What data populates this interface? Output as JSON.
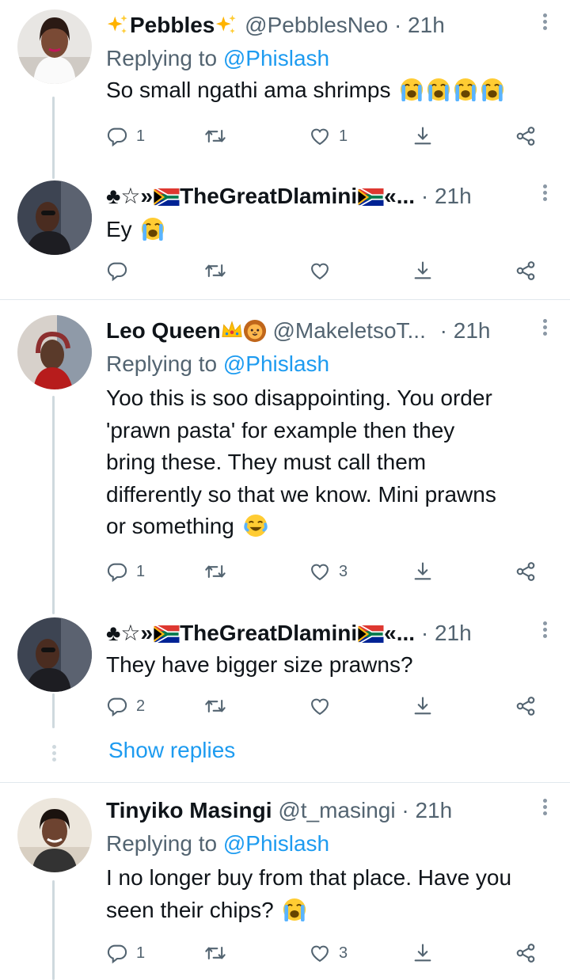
{
  "reply_prefix": "Replying to ",
  "tweets": [
    {
      "name": "Pebbles",
      "handle": "@PebblesNeo",
      "time": "21h",
      "reply_to": "@Phislash",
      "text": "So small ngathi ama shrimps",
      "replies": "1",
      "likes": "1"
    },
    {
      "name_prefix": "♣☆»",
      "name": "TheGreatDlamini",
      "name_suffix": "«...",
      "time": "21h",
      "text": "Ey"
    },
    {
      "name": "Leo Queen",
      "handle": "@MakeletsoT...",
      "time": "21h",
      "reply_to": "@Phislash",
      "text_lines": [
        "Yoo this is soo disappointing. You order",
        "'prawn pasta' for example then they",
        "bring these. They must call them",
        "differently so that we know. Mini prawns",
        "or something"
      ],
      "replies": "1",
      "likes": "3"
    },
    {
      "name_prefix": "♣☆»",
      "name": "TheGreatDlamini",
      "name_suffix": "«...",
      "time": "21h",
      "text": "They have bigger size prawns?",
      "replies": "2"
    },
    {
      "name": "Tinyiko Masingi",
      "handle": "@t_masingi",
      "time": "21h",
      "reply_to": "@Phislash",
      "text_lines": [
        "I no longer buy from that place. Have you",
        "seen their chips?"
      ],
      "replies": "1",
      "likes": "3"
    }
  ],
  "show_replies_label": "Show replies",
  "separator": "·",
  "colors": {
    "link": "#1d9bf0",
    "muted": "#536471",
    "thread_line": "#cfd9de"
  }
}
